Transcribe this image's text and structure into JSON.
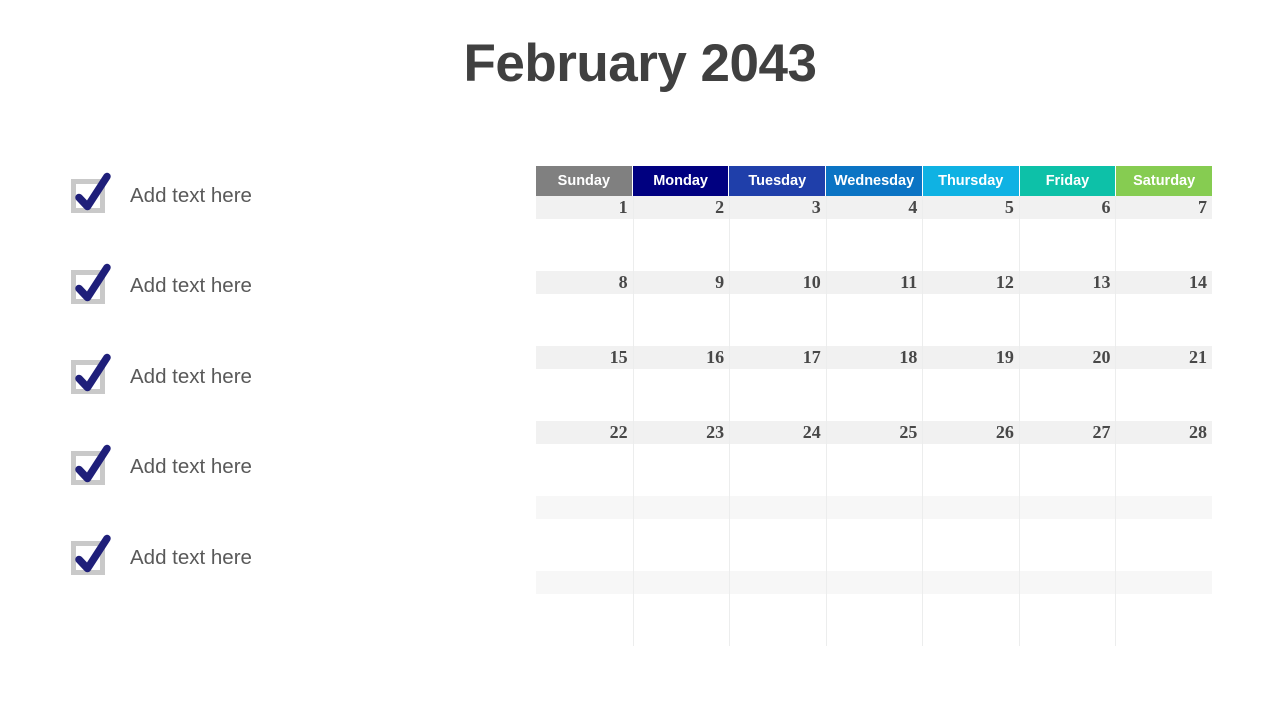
{
  "page": {
    "title": "February 2043",
    "background_color": "#ffffff"
  },
  "checklist": {
    "items": [
      {
        "label": "Add text here",
        "checked": true
      },
      {
        "label": "Add text here",
        "checked": true
      },
      {
        "label": "Add text here",
        "checked": true
      },
      {
        "label": "Add text here",
        "checked": true
      },
      {
        "label": "Add text here",
        "checked": true
      }
    ],
    "checkbox_border_color": "#c9c9c9",
    "checkmark_color": "#1f1f7a",
    "label_color": "#595959"
  },
  "calendar": {
    "month": "February",
    "year": "2043",
    "weekdays": [
      {
        "label": "Sunday",
        "color": "#808080"
      },
      {
        "label": "Monday",
        "color": "#000080"
      },
      {
        "label": "Tuesday",
        "color": "#1f3faa"
      },
      {
        "label": "Wednesday",
        "color": "#0b74c4"
      },
      {
        "label": "Thursday",
        "color": "#0fb2e3"
      },
      {
        "label": "Friday",
        "color": "#0dc1a8"
      },
      {
        "label": "Saturday",
        "color": "#86cc51"
      }
    ],
    "weeks": [
      {
        "dates": [
          "1",
          "2",
          "3",
          "4",
          "5",
          "6",
          "7"
        ]
      },
      {
        "dates": [
          "8",
          "9",
          "10",
          "11",
          "12",
          "13",
          "14"
        ]
      },
      {
        "dates": [
          "15",
          "16",
          "17",
          "18",
          "19",
          "20",
          "21"
        ]
      },
      {
        "dates": [
          "22",
          "23",
          "24",
          "25",
          "26",
          "27",
          "28"
        ]
      },
      {
        "dates": [
          "",
          "",
          "",
          "",
          "",
          "",
          ""
        ]
      },
      {
        "dates": [
          "",
          "",
          "",
          "",
          "",
          "",
          ""
        ]
      }
    ],
    "date_band_color": "#f1f1f1",
    "empty_band_color": "#f7f7f7",
    "grid_line_color": "#eceded",
    "date_text_color": "#484848"
  }
}
